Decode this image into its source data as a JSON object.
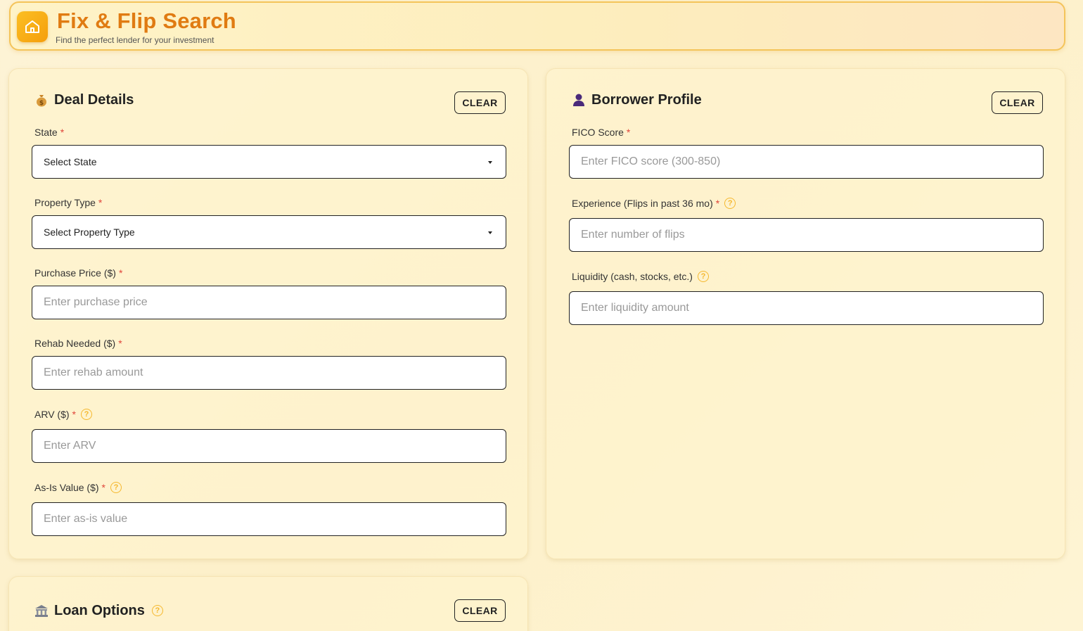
{
  "header": {
    "title": "Fix & Flip Search",
    "subtitle": "Find the perfect lender for your investment",
    "logo_icon": "home-icon"
  },
  "deal": {
    "title": "Deal Details",
    "clear_label": "CLEAR",
    "state_label": "State",
    "state_value": "Select State",
    "property_label": "Property Type",
    "property_value": "Select Property Type",
    "purchase_label": "Purchase Price ($)",
    "purchase_placeholder": "Enter purchase price",
    "rehab_label": "Rehab Needed ($)",
    "rehab_placeholder": "Enter rehab amount",
    "arv_label": "ARV ($)",
    "arv_placeholder": "Enter ARV",
    "asis_label": "As-Is Value ($)",
    "asis_placeholder": "Enter as-is value"
  },
  "borrower": {
    "title": "Borrower Profile",
    "clear_label": "CLEAR",
    "fico_label": "FICO Score",
    "fico_placeholder": "Enter FICO score (300-850)",
    "exp_label": "Experience (Flips in past 36 mo)",
    "exp_placeholder": "Enter number of flips",
    "liq_label": "Liquidity (cash, stocks, etc.)",
    "liq_placeholder": "Enter liquidity amount"
  },
  "loan": {
    "title": "Loan Options",
    "clear_label": "CLEAR"
  },
  "required_mark": "*",
  "help_mark": "?",
  "colors": {
    "accent": "#e07b12",
    "required": "#e0453a",
    "help": "#f5b82e"
  }
}
